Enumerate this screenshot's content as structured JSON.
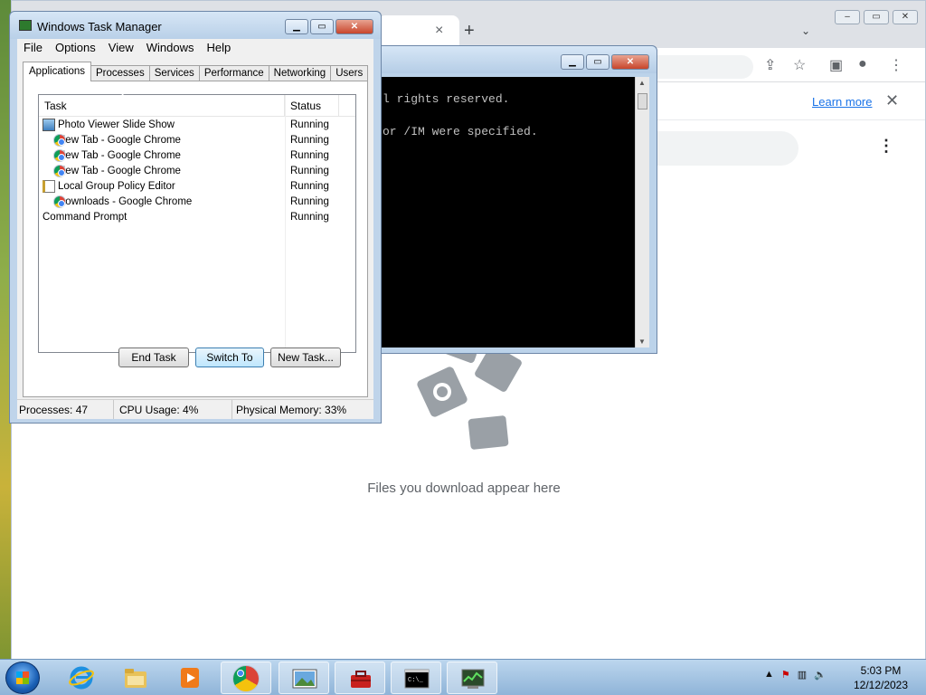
{
  "chrome": {
    "tab_close": "×",
    "new_tab": "+",
    "tab_search": "⌄",
    "toolbar_icons": [
      "share-icon",
      "star-icon",
      "side-panel-icon",
      "profile-icon",
      "menu-icon"
    ],
    "infobar": {
      "link": "Learn more",
      "close": "✕"
    },
    "downloads_empty_text": "Files you download appear here",
    "kebab": "⋮"
  },
  "cmd": {
    "lines": [
      "l rights reserved.",
      "or /IM were specified."
    ]
  },
  "task_manager": {
    "title": "Windows Task Manager",
    "menu": [
      "File",
      "Options",
      "View",
      "Windows",
      "Help"
    ],
    "tabs": [
      "Applications",
      "Processes",
      "Services",
      "Performance",
      "Networking",
      "Users"
    ],
    "active_tab": "Applications",
    "columns": {
      "task": "Task",
      "status": "Status"
    },
    "rows": [
      {
        "icon": "photo-viewer-icon",
        "task": "Photo Viewer Slide Show",
        "status": "Running"
      },
      {
        "icon": "chrome-icon",
        "task": "New Tab - Google Chrome",
        "status": "Running"
      },
      {
        "icon": "chrome-icon",
        "task": "New Tab - Google Chrome",
        "status": "Running"
      },
      {
        "icon": "chrome-icon",
        "task": "New Tab - Google Chrome",
        "status": "Running"
      },
      {
        "icon": "group-policy-icon",
        "task": "Local Group Policy Editor",
        "status": "Running"
      },
      {
        "icon": "chrome-icon",
        "task": "Downloads - Google Chrome",
        "status": "Running"
      },
      {
        "icon": "command-prompt-icon",
        "task": "Command Prompt",
        "status": "Running"
      }
    ],
    "buttons": {
      "end_task": "End Task",
      "switch_to": "Switch To",
      "new_task": "New Task..."
    },
    "status_bar": {
      "processes": "Processes: 47",
      "cpu": "CPU Usage: 4%",
      "memory": "Physical Memory: 33%"
    }
  },
  "taskbar": {
    "items": [
      "start-button",
      "internet-explorer-icon",
      "file-explorer-icon",
      "media-player-icon",
      "chrome-icon",
      "photo-viewer-icon",
      "toolbox-icon",
      "command-prompt-icon",
      "task-manager-icon"
    ],
    "tray_arrow": "▲",
    "time": "5:03 PM",
    "date": "12/12/2023"
  }
}
